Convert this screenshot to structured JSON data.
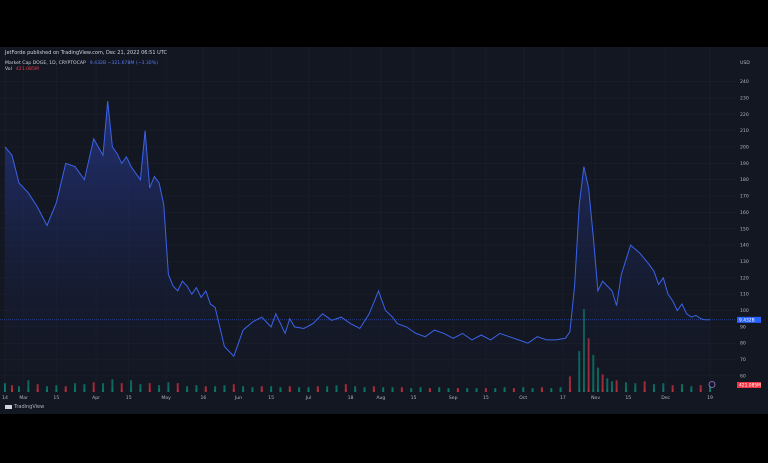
{
  "header": {
    "text": "JetForde published on TradingView.com, Dec 21, 2022 06:51 UTC"
  },
  "legend": {
    "series_label": "Market Cap DOGE, 1D, CRYPTOCAP",
    "series_value": "9.432B −321.678M (−3.30%)",
    "volume_label": "Vol",
    "volume_value": "421.085M"
  },
  "footer": {
    "brand": "TradingView"
  },
  "colors": {
    "background": "#131722",
    "line": "#3b62e8",
    "area_top": "#1f3278",
    "vol_up": "#089981",
    "vol_down": "#f23645",
    "grid": "#1f2230",
    "text": "#d1d4dc"
  },
  "chart_data": {
    "type": "area",
    "title": "Market Cap DOGE, 1D, CRYPTOCAP",
    "ylabel": "USD",
    "unit": "B",
    "ylim": [
      52,
      252
    ],
    "y_ticks": [
      "60",
      "70",
      "80",
      "90",
      "100",
      "110",
      "120",
      "130",
      "140",
      "150",
      "160",
      "170",
      "180",
      "190",
      "200",
      "210",
      "220",
      "230",
      "240"
    ],
    "current_label": "9.432B",
    "volume_label": "421.085M",
    "x_ticks": [
      "14",
      "Mar",
      "15",
      "Apr",
      "15",
      "May",
      "16",
      "Jun",
      "15",
      "Jul",
      "18",
      "Aug",
      "15",
      "Sep",
      "15",
      "Oct",
      "17",
      "Nov",
      "15",
      "Dec",
      "19"
    ],
    "x_tick_days": [
      0,
      8,
      22,
      39,
      53,
      69,
      85,
      100,
      114,
      130,
      148,
      161,
      175,
      192,
      206,
      222,
      239,
      253,
      267,
      283,
      302
    ],
    "series": [
      {
        "x": [
          0,
          3,
          6,
          10,
          14,
          18,
          22,
          26,
          30,
          34,
          38,
          42,
          44,
          46,
          48,
          50,
          52,
          54,
          56,
          58,
          60,
          62,
          64,
          66,
          68,
          70,
          72,
          74,
          76,
          78,
          80,
          82,
          84,
          86,
          88,
          90,
          94,
          98,
          102,
          106,
          110,
          114,
          116,
          118,
          120,
          122,
          124,
          128,
          132,
          136,
          140,
          144,
          148,
          152,
          156,
          160,
          163,
          166,
          168,
          172,
          176,
          180,
          184,
          188,
          192,
          196,
          200,
          204,
          208,
          212,
          216,
          220,
          224,
          228,
          232,
          236,
          240,
          242,
          244,
          246,
          248,
          250,
          252,
          254,
          256,
          258,
          260,
          262,
          264,
          268,
          272,
          276,
          278,
          280,
          282,
          284,
          286,
          288,
          290,
          292,
          294,
          296,
          298,
          300,
          302
        ],
        "y": [
          200,
          195,
          178,
          172,
          163,
          152,
          166,
          190,
          188,
          180,
          205,
          195,
          228,
          200,
          196,
          190,
          194,
          188,
          184,
          180,
          210,
          175,
          182,
          178,
          165,
          122,
          115,
          112,
          118,
          115,
          110,
          114,
          108,
          112,
          104,
          102,
          78,
          72,
          88,
          93,
          96,
          90,
          98,
          92,
          86,
          95,
          90,
          89,
          92,
          98,
          94,
          96,
          92,
          89,
          98,
          112,
          100,
          96,
          92,
          90,
          86,
          84,
          88,
          86,
          83,
          86,
          82,
          85,
          82,
          86,
          84,
          82,
          80,
          84,
          82,
          82,
          83,
          87,
          115,
          165,
          188,
          175,
          145,
          112,
          118,
          115,
          112,
          103,
          122,
          140,
          135,
          128,
          124,
          116,
          120,
          110,
          106,
          100,
          104,
          98,
          96,
          97,
          95,
          94.3,
          94.3
        ]
      }
    ],
    "volume": {
      "days": [
        0,
        3,
        6,
        10,
        14,
        18,
        22,
        26,
        30,
        34,
        38,
        42,
        46,
        50,
        54,
        58,
        62,
        66,
        70,
        74,
        78,
        82,
        86,
        90,
        94,
        98,
        102,
        106,
        110,
        114,
        118,
        122,
        126,
        130,
        134,
        138,
        142,
        146,
        150,
        154,
        158,
        162,
        166,
        170,
        174,
        178,
        182,
        186,
        190,
        194,
        198,
        202,
        206,
        210,
        214,
        218,
        222,
        226,
        230,
        234,
        238,
        242,
        246,
        248,
        250,
        252,
        254,
        256,
        258,
        260,
        262,
        266,
        270,
        274,
        278,
        282,
        286,
        290,
        294,
        298,
        302
      ],
      "values": [
        0.9,
        0.7,
        0.6,
        1.2,
        0.8,
        0.6,
        0.7,
        0.6,
        0.9,
        0.8,
        1.0,
        0.9,
        1.3,
        0.9,
        1.2,
        0.8,
        0.9,
        0.7,
        1.0,
        0.9,
        0.6,
        0.7,
        0.6,
        0.6,
        0.7,
        0.8,
        0.6,
        0.5,
        0.6,
        0.6,
        0.5,
        0.6,
        0.5,
        0.5,
        0.6,
        0.6,
        0.7,
        0.8,
        0.6,
        0.5,
        0.6,
        0.5,
        0.5,
        0.5,
        0.4,
        0.5,
        0.4,
        0.5,
        0.4,
        0.4,
        0.4,
        0.4,
        0.4,
        0.4,
        0.5,
        0.4,
        0.5,
        0.4,
        0.5,
        0.4,
        0.5,
        1.6,
        4.2,
        8.5,
        5.5,
        3.8,
        2.5,
        1.8,
        1.4,
        1.1,
        1.2,
        1.0,
        0.9,
        1.1,
        0.8,
        0.9,
        0.7,
        0.8,
        0.6,
        0.7,
        0.6
      ]
    }
  }
}
